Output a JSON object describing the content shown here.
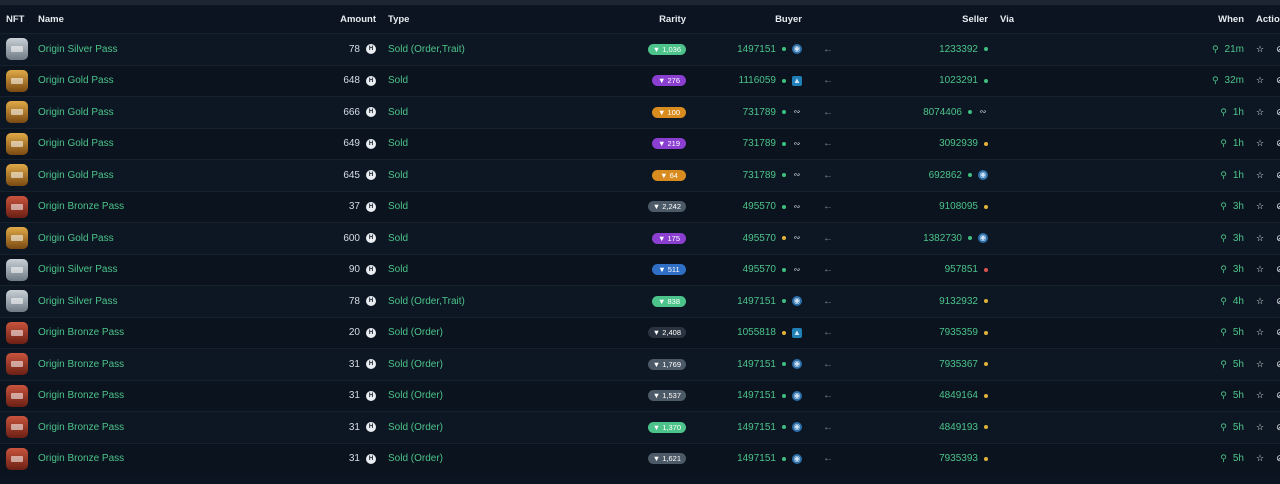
{
  "headers": {
    "nft": "NFT",
    "name": "Name",
    "amount": "Amount",
    "type": "Type",
    "rarity": "Rarity",
    "buyer": "Buyer",
    "seller": "Seller",
    "via": "Via",
    "when": "When",
    "actions": "Actions"
  },
  "currency_symbol": "H",
  "colors": {
    "green": "#4cc38a",
    "purple": "#8a3fd1",
    "orange": "#d88b1e",
    "blue": "#2f6fc6",
    "gray": "#4c5966",
    "dark": "#2a3340",
    "dot_green": "#3fbf7f",
    "dot_yellow": "#e0b23a",
    "dot_red": "#d9534f"
  },
  "rows": [
    {
      "tier": "silver",
      "name": "Origin Silver Pass",
      "amount": "78",
      "type": "Sold (Order,Trait)",
      "rarity": "1,036",
      "rarity_color": "green",
      "buyer": "1497151",
      "buyer_dot": "dot_green",
      "buyer_badge": "whale",
      "seller": "1233392",
      "seller_dot": "dot_green",
      "seller_badge": "",
      "when": "21m"
    },
    {
      "tier": "gold",
      "name": "Origin Gold Pass",
      "amount": "648",
      "type": "Sold",
      "rarity": "276",
      "rarity_color": "purple",
      "buyer": "1116059",
      "buyer_dot": "dot_green",
      "buyer_badge": "shark",
      "seller": "1023291",
      "seller_dot": "dot_green",
      "seller_badge": "",
      "when": "32m"
    },
    {
      "tier": "gold",
      "name": "Origin Gold Pass",
      "amount": "666",
      "type": "Sold",
      "rarity": "100",
      "rarity_color": "orange",
      "buyer": "731789",
      "buyer_dot": "dot_green",
      "buyer_badge": "shrimp",
      "seller": "8074406",
      "seller_dot": "dot_green",
      "seller_badge": "shrimp",
      "when": "1h"
    },
    {
      "tier": "gold",
      "name": "Origin Gold Pass",
      "amount": "649",
      "type": "Sold",
      "rarity": "219",
      "rarity_color": "purple",
      "buyer": "731789",
      "buyer_dot": "dot_green",
      "buyer_badge": "shrimp",
      "seller": "3092939",
      "seller_dot": "dot_yellow",
      "seller_badge": "",
      "when": "1h"
    },
    {
      "tier": "gold",
      "name": "Origin Gold Pass",
      "amount": "645",
      "type": "Sold",
      "rarity": "64",
      "rarity_color": "orange",
      "buyer": "731789",
      "buyer_dot": "dot_green",
      "buyer_badge": "shrimp",
      "seller": "692862",
      "seller_dot": "dot_green",
      "seller_badge": "whale",
      "when": "1h"
    },
    {
      "tier": "bronze",
      "name": "Origin Bronze Pass",
      "amount": "37",
      "type": "Sold",
      "rarity": "2,242",
      "rarity_color": "gray",
      "buyer": "495570",
      "buyer_dot": "dot_green",
      "buyer_badge": "shrimp",
      "seller": "9108095",
      "seller_dot": "dot_yellow",
      "seller_badge": "",
      "when": "3h"
    },
    {
      "tier": "gold",
      "name": "Origin Gold Pass",
      "amount": "600",
      "type": "Sold",
      "rarity": "175",
      "rarity_color": "purple",
      "buyer": "495570",
      "buyer_dot": "dot_yellow",
      "buyer_badge": "shrimp",
      "seller": "1382730",
      "seller_dot": "dot_green",
      "seller_badge": "whale",
      "when": "3h"
    },
    {
      "tier": "silver",
      "name": "Origin Silver Pass",
      "amount": "90",
      "type": "Sold",
      "rarity": "511",
      "rarity_color": "blue",
      "buyer": "495570",
      "buyer_dot": "dot_green",
      "buyer_badge": "shrimp",
      "seller": "957851",
      "seller_dot": "dot_red",
      "seller_badge": "",
      "when": "3h"
    },
    {
      "tier": "silver",
      "name": "Origin Silver Pass",
      "amount": "78",
      "type": "Sold (Order,Trait)",
      "rarity": "838",
      "rarity_color": "green",
      "buyer": "1497151",
      "buyer_dot": "dot_green",
      "buyer_badge": "whale",
      "seller": "9132932",
      "seller_dot": "dot_yellow",
      "seller_badge": "",
      "when": "4h"
    },
    {
      "tier": "bronze",
      "name": "Origin Bronze Pass",
      "amount": "20",
      "type": "Sold (Order)",
      "rarity": "2,408",
      "rarity_color": "dark",
      "buyer": "1055818",
      "buyer_dot": "dot_yellow",
      "buyer_badge": "shark",
      "seller": "7935359",
      "seller_dot": "dot_yellow",
      "seller_badge": "",
      "when": "5h"
    },
    {
      "tier": "bronze",
      "name": "Origin Bronze Pass",
      "amount": "31",
      "type": "Sold (Order)",
      "rarity": "1,769",
      "rarity_color": "gray",
      "buyer": "1497151",
      "buyer_dot": "dot_green",
      "buyer_badge": "whale",
      "seller": "7935367",
      "seller_dot": "dot_yellow",
      "seller_badge": "",
      "when": "5h"
    },
    {
      "tier": "bronze",
      "name": "Origin Bronze Pass",
      "amount": "31",
      "type": "Sold (Order)",
      "rarity": "1,537",
      "rarity_color": "gray",
      "buyer": "1497151",
      "buyer_dot": "dot_green",
      "buyer_badge": "whale",
      "seller": "4849164",
      "seller_dot": "dot_yellow",
      "seller_badge": "",
      "when": "5h"
    },
    {
      "tier": "bronze",
      "name": "Origin Bronze Pass",
      "amount": "31",
      "type": "Sold (Order)",
      "rarity": "1,370",
      "rarity_color": "green",
      "buyer": "1497151",
      "buyer_dot": "dot_green",
      "buyer_badge": "whale",
      "seller": "4849193",
      "seller_dot": "dot_yellow",
      "seller_badge": "",
      "when": "5h"
    },
    {
      "tier": "bronze",
      "name": "Origin Bronze Pass",
      "amount": "31",
      "type": "Sold (Order)",
      "rarity": "1,621",
      "rarity_color": "gray",
      "buyer": "1497151",
      "buyer_dot": "dot_green",
      "buyer_badge": "whale",
      "seller": "7935393",
      "seller_dot": "dot_yellow",
      "seller_badge": "",
      "when": "5h"
    }
  ]
}
